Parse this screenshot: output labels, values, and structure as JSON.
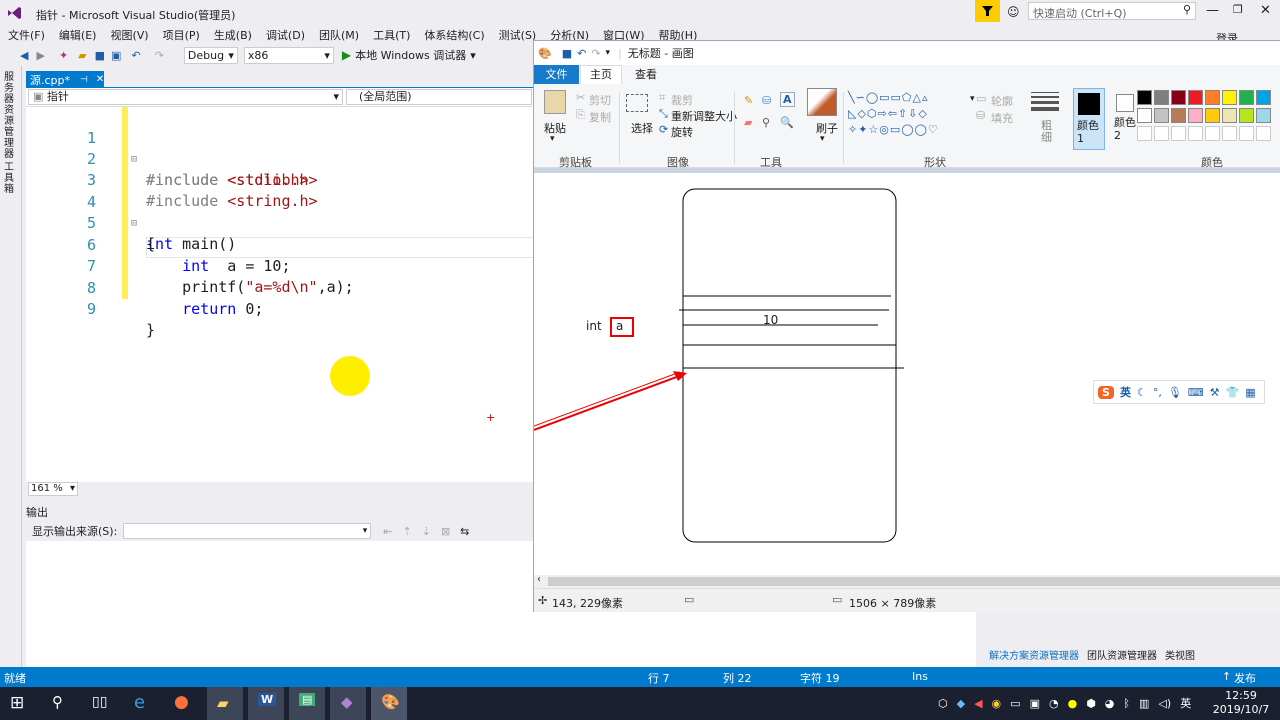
{
  "vs": {
    "window_title": "指针 - Microsoft Visual Studio(管理员)",
    "menu": [
      "文件(F)",
      "编辑(E)",
      "视图(V)",
      "项目(P)",
      "生成(B)",
      "调试(D)",
      "团队(M)",
      "工具(T)",
      "体系结构(C)",
      "测试(S)",
      "分析(N)",
      "窗口(W)",
      "帮助(H)"
    ],
    "quick_launch_placeholder": "快速启动 (Ctrl+Q)",
    "login": "登录",
    "config": "Debug",
    "platform": "x86",
    "run_label": "本地 Windows 调试器",
    "left_strip_1": "服务器资源管理器",
    "left_strip_2": "工具箱",
    "doc_tab": "源.cpp*",
    "nav_left": "指针",
    "nav_right": "(全局范围)",
    "code": [
      {
        "ln": "1",
        "text": "#include <stdio.h>"
      },
      {
        "ln": "2",
        "text": "#include <stdlib.h>"
      },
      {
        "ln": "3",
        "text": "#include <string.h>"
      },
      {
        "ln": "4",
        "text": "int main()"
      },
      {
        "ln": "5",
        "text": "{"
      },
      {
        "ln": "6",
        "text": "    int  a = 10;"
      },
      {
        "ln": "7",
        "text": "    printf(\"a=%d\\n\",a);"
      },
      {
        "ln": "8",
        "text": "    return 0;"
      },
      {
        "ln": "9",
        "text": "}"
      }
    ],
    "zoom": "161 %",
    "output_title": "输出",
    "output_source_label": "显示输出来源(S):",
    "right_tabs": [
      "解决方案资源管理器",
      "团队资源管理器",
      "类视图"
    ],
    "publish": "发布",
    "status": {
      "ready": "就绪",
      "row": "行 7",
      "col": "列 22",
      "char": "字符 19",
      "ins": "Ins"
    }
  },
  "paint": {
    "title": "无标题 - 画图",
    "tabs": [
      "文件",
      "主页",
      "查看"
    ],
    "clipboard": {
      "paste": "粘贴",
      "cut": "剪切",
      "copy": "复制",
      "label": "剪贴板"
    },
    "image": {
      "select": "选择",
      "crop": "裁剪",
      "resize": "重新调整大小",
      "rotate": "旋转",
      "label": "图像"
    },
    "tools_label": "工具",
    "brush": "刷子",
    "shapes": {
      "outline": "轮廓",
      "fill": "填充",
      "label": "形状"
    },
    "thickness": "粗细",
    "color1": "颜色 1",
    "color2": "颜色 2",
    "colors_label": "颜色",
    "palette": [
      "#000000",
      "#7f7f7f",
      "#880015",
      "#ed1c24",
      "#ff7f27",
      "#fff200",
      "#22b14c",
      "#00a2e8",
      "#ffffff",
      "#c3c3c3",
      "#b97a57",
      "#ffaec9",
      "#ffc90e",
      "#efe4b0",
      "#b5e61d",
      "#99d9ea"
    ],
    "drawing": {
      "type_label": "int",
      "var_label": "a",
      "value": "10"
    },
    "status_pos": "143, 229像素",
    "status_size": "1506 × 789像素"
  },
  "ime": {
    "lang": "英"
  },
  "taskbar": {
    "time": "12:59",
    "date": "2019/10/7",
    "lang": "英"
  }
}
